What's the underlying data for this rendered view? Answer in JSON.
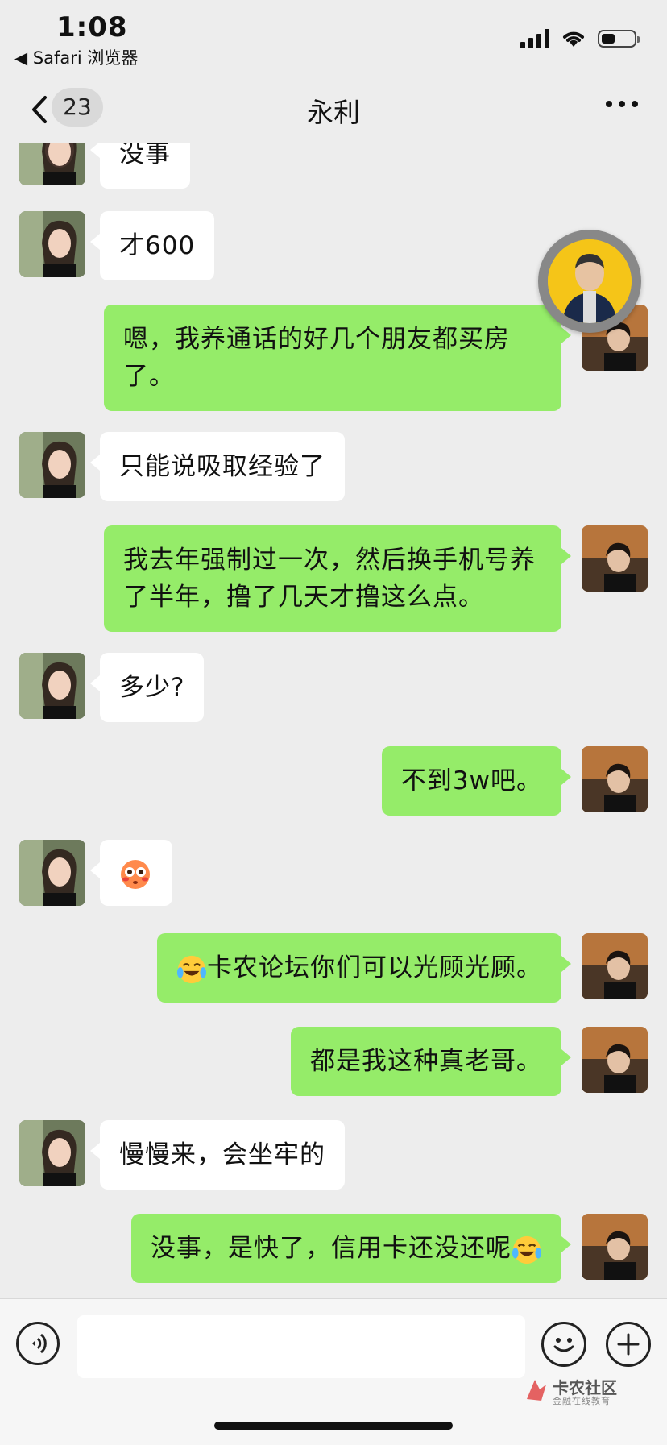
{
  "status_bar": {
    "time": "1:08",
    "back_app": "◀ Safari 浏览器",
    "battery_level": 0.4
  },
  "nav": {
    "unread_count": "23",
    "title": "永利"
  },
  "messages": [
    {
      "side": "in",
      "text": "没事"
    },
    {
      "side": "in",
      "text": "才600"
    },
    {
      "side": "out",
      "text": "嗯，我养通话的好几个朋友都买房了。"
    },
    {
      "side": "in",
      "text": "只能说吸取经验了"
    },
    {
      "side": "out",
      "text": "我去年强制过一次，然后换手机号养了半年，撸了几天才撸这么点。"
    },
    {
      "side": "in",
      "text": "多少?"
    },
    {
      "side": "out",
      "text": "不到3w吧。"
    },
    {
      "side": "in",
      "emoji": "flushed-face"
    },
    {
      "side": "out",
      "text": "卡农论坛你们可以光顾光顾。",
      "leading_emoji": "crying-laughing-face"
    },
    {
      "side": "out",
      "text": "都是我这种真老哥。"
    },
    {
      "side": "in",
      "text": "慢慢来，会坐牢的"
    },
    {
      "side": "out",
      "text": "没事，是快了，信用卡还没还呢",
      "trailing_emoji": "crying-laughing-face"
    }
  ],
  "input_bar": {
    "placeholder": ""
  },
  "watermark": {
    "main": "卡农社区",
    "sub": "金融在线教育"
  },
  "colors": {
    "out_bubble": "#95ec69",
    "in_bubble": "#ffffff",
    "background": "#ededed"
  }
}
